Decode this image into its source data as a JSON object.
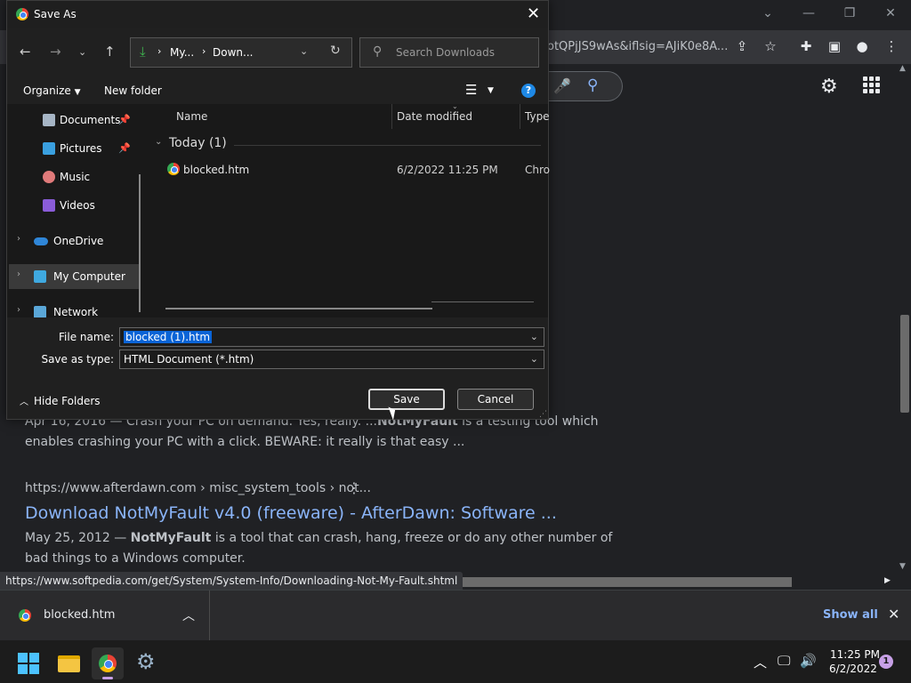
{
  "browser": {
    "omnibox_tail": "otQPjJS9wAs&iflsig=AJiK0e8A...",
    "results": [
      {
        "snippet_1": "Apr 16, 2016 — Crash your PC on demand. Yes, really. ...",
        "snippet_bold": "NotMyFault",
        "snippet_2": " is a testing tool which",
        "snippet_line2": "enables crashing your PC with a click. BEWARE: it really is that easy ..."
      },
      {
        "url": "https://www.afterdawn.com › misc_system_tools › not...",
        "title": "Download NotMyFault v4.0 (freeware) - AfterDawn: Software ...",
        "snippet_1": "May 25, 2012 — ",
        "snippet_bold": "NotMyFault",
        "snippet_2": " is a tool that can crash, hang, freeze or do any other number of",
        "snippet_line2": "bad things to a Windows computer."
      }
    ],
    "status_url": "https://www.softpedia.com/get/System/System-Info/Downloading-Not-My-Fault.shtml"
  },
  "download_bar": {
    "file_name": "blocked.htm",
    "show_all": "Show all"
  },
  "taskbar": {
    "time": "11:25 PM",
    "date": "6/2/2022",
    "notifications": "1"
  },
  "dialog": {
    "title": "Save As",
    "address": {
      "seg1": "My...",
      "seg2": "Down..."
    },
    "search_placeholder": "Search Downloads",
    "organize": "Organize",
    "new_folder": "New folder",
    "nav_items": {
      "documents": "Documents",
      "pictures": "Pictures",
      "music": "Music",
      "videos": "Videos",
      "onedrive": "OneDrive",
      "my_computer": "My Computer",
      "network": "Network"
    },
    "columns": {
      "name": "Name",
      "date": "Date modified",
      "type": "Type"
    },
    "group": "Today (1)",
    "file": {
      "name": "blocked.htm",
      "date": "6/2/2022 11:25 PM",
      "type": "Chro"
    },
    "file_name_label": "File name:",
    "file_name_value": "blocked (1).htm",
    "save_type_label": "Save as type:",
    "save_type_value": "HTML Document (*.htm)",
    "hide_folders": "Hide Folders",
    "save": "Save",
    "cancel": "Cancel"
  }
}
